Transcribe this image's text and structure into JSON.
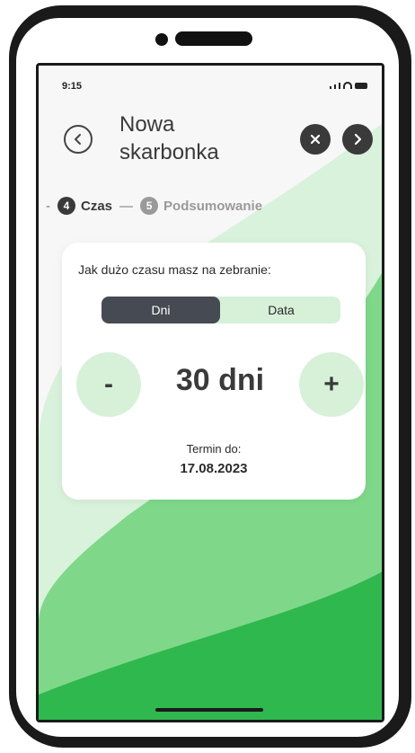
{
  "status": {
    "time": "9:15"
  },
  "header": {
    "title": "Nowa skarbonka"
  },
  "steps": {
    "lead": "-",
    "active": {
      "number": "4",
      "label": "Czas"
    },
    "dash": "—",
    "next": {
      "number": "5",
      "label": "Podsumowanie"
    }
  },
  "card": {
    "question": "Jak dużo czasu masz na zebranie:",
    "toggle": {
      "selected": "Dni",
      "other": "Data"
    },
    "stepper": {
      "minus": "-",
      "value": "30 dni",
      "plus": "+"
    },
    "deadline_label": "Termin do:",
    "deadline_date": "17.08.2023"
  },
  "colors": {
    "accent_green": "#2fb84e",
    "light_green": "#d6f1d8",
    "dark": "#3a3a3a"
  },
  "icons": {
    "back": "chevron-left-circle-icon",
    "close": "close-icon",
    "next": "chevron-right-icon"
  }
}
